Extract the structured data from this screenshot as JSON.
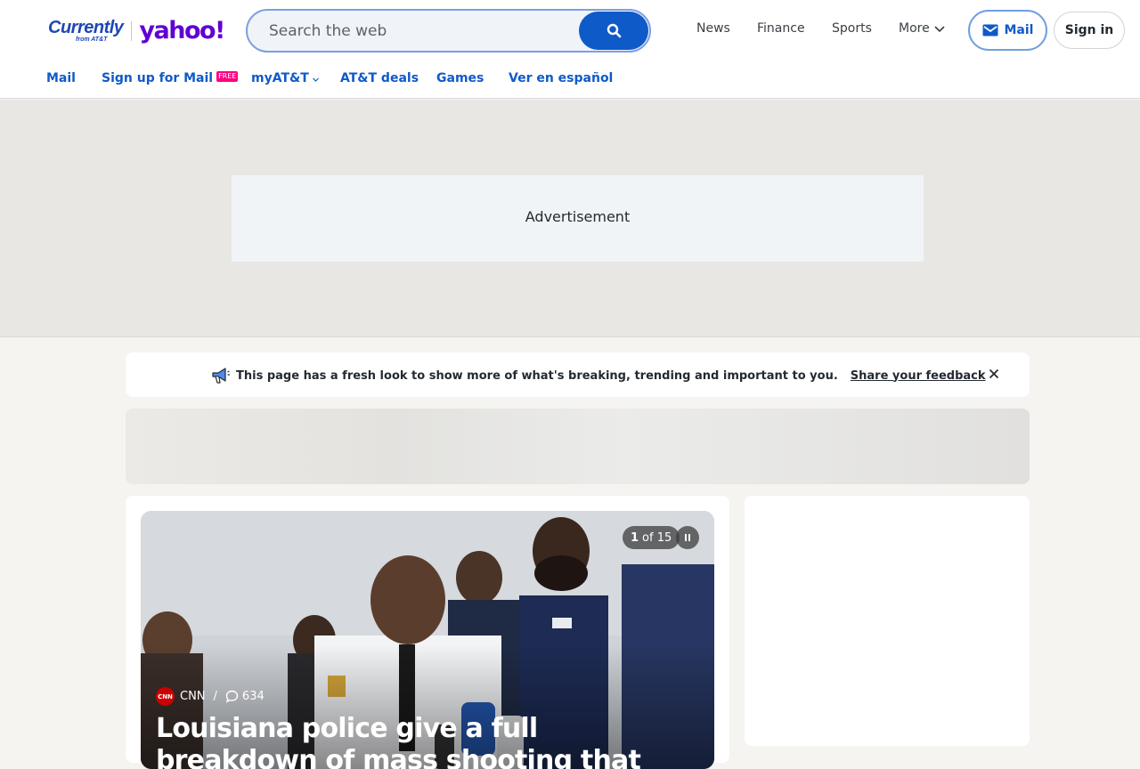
{
  "brand": {
    "currently_text": "Currently",
    "from_text": "from AT&T",
    "yahoo_text": "yahoo!",
    "primary_color": "#6001d2",
    "currently_color": "#1d47b8"
  },
  "search": {
    "placeholder": "Search the web",
    "button_color": "#0f5ac9"
  },
  "topnav": {
    "news": "News",
    "finance": "Finance",
    "sports": "Sports",
    "more": "More"
  },
  "header_buttons": {
    "mail": "Mail",
    "sign_in": "Sign in"
  },
  "subnav": {
    "mail": "Mail",
    "signup": "Sign up for Mail",
    "free_badge": "FREE",
    "myatt": "myAT&T",
    "deals": "AT&T deals",
    "games": "Games",
    "espanol": "Ver en español"
  },
  "ad": {
    "label": "Advertisement"
  },
  "notice": {
    "message": "This page has a fresh look to show more of what's breaking, trending and important to you.",
    "feedback_link": "Share your feedback"
  },
  "hero": {
    "counter_current": "1",
    "counter_total": "of 15",
    "source": "CNN",
    "source_logo_text": "CNN",
    "comment_count": "634",
    "headline": "Louisiana police give a full breakdown of mass shooting that"
  }
}
